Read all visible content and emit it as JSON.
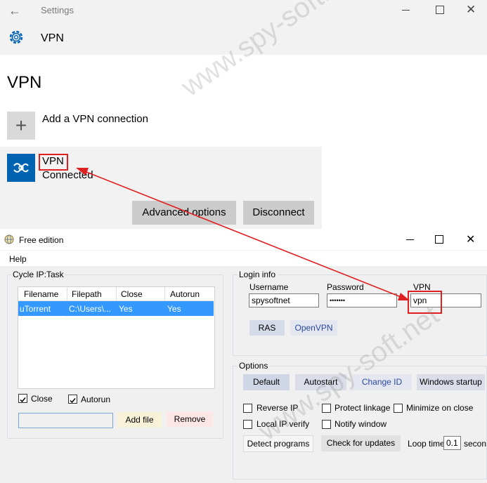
{
  "settings": {
    "window_title": "Settings",
    "header": "VPN",
    "page_title": "VPN",
    "add_connection": "Add a VPN connection",
    "connection": {
      "name": "VPN",
      "status": "Connected"
    },
    "advanced_button": "Advanced options",
    "disconnect_button": "Disconnect",
    "accent_color": "#0063b1"
  },
  "app": {
    "window_title": "Free edition",
    "menu": [
      "Help"
    ],
    "cycle": {
      "label": "Cycle IP:Task",
      "columns": [
        "Filename",
        "Filepath",
        "Close",
        "Autorun"
      ],
      "rows": [
        {
          "filename": "uTorrent",
          "filepath": "C:\\Users\\...",
          "close": "Yes",
          "autorun": "Yes"
        }
      ],
      "close_label": "Close",
      "autorun_label": "Autorun",
      "add_file": "Add file",
      "remove": "Remove"
    },
    "login": {
      "label": "Login info",
      "username_label": "Username",
      "username_value": "spysoftnet",
      "password_label": "Password",
      "password_value": "•••••••",
      "vpn_label": "VPN",
      "vpn_value": "vpn",
      "ras": "RAS",
      "openvpn": "OpenVPN"
    },
    "options": {
      "label": "Options",
      "buttons": [
        "Default",
        "Autostart",
        "Change ID",
        "Windows startup"
      ],
      "checks": [
        "Reverse IP",
        "Protect linkage",
        "Minimize on close",
        "Local IP verify",
        "Notify window"
      ],
      "detect": "Detect programs",
      "check_updates": "Check for updates",
      "loop_label": "Loop time",
      "loop_value": "0.1",
      "loop_unit": "secon"
    }
  },
  "watermark": "www.spy-soft.net"
}
